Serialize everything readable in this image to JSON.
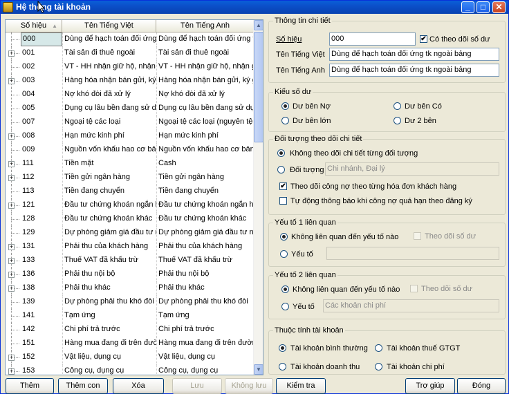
{
  "window": {
    "title": "Hệ thống tài khoản",
    "min": "_",
    "max": "□",
    "close": "✕"
  },
  "grid": {
    "headers": [
      "Số hiệu",
      "Tên Tiếng Việt",
      "Tên Tiếng Anh"
    ],
    "sort_indicator": "▲",
    "rows": [
      {
        "code": "000",
        "vn": "Dùng để hạch toán đối ứng",
        "en": "Dùng để hạch toán đối ứng t",
        "plus": false
      },
      {
        "code": "001",
        "vn": "Tài sản đi thuê ngoài",
        "en": "Tài sản đi thuê ngoài",
        "plus": true
      },
      {
        "code": "002",
        "vn": "VT - HH nhận giữ hộ, nhận g",
        "en": "VT - HH nhận giữ hộ, nhận g",
        "plus": false
      },
      {
        "code": "003",
        "vn": "Hàng hóa nhận bán gửi, ký g",
        "en": "Hàng hóa nhận bán gửi, ký g",
        "plus": true
      },
      {
        "code": "004",
        "vn": "Nợ khó đòi đã xử lý",
        "en": "Nợ khó đòi đã xử lý",
        "plus": false
      },
      {
        "code": "005",
        "vn": "Dụng cụ lâu bền đang sử dụ",
        "en": "Dụng cụ lâu bền đang sử dụ",
        "plus": false
      },
      {
        "code": "007",
        "vn": "Ngoại tệ các loại",
        "en": "Ngoại tệ các loại (nguyên tệ",
        "plus": false
      },
      {
        "code": "008",
        "vn": "Hạn mức kinh phí",
        "en": "Hạn mức kinh phí",
        "plus": true
      },
      {
        "code": "009",
        "vn": "Nguồn vốn khấu hao cơ bản",
        "en": "Nguồn vốn khấu hao cơ bản",
        "plus": false
      },
      {
        "code": "111",
        "vn": "Tiền mặt",
        "en": "Cash",
        "plus": true
      },
      {
        "code": "112",
        "vn": "Tiền gửi ngân hàng",
        "en": "Tiền gửi ngân hàng",
        "plus": true
      },
      {
        "code": "113",
        "vn": "Tiền đang chuyển",
        "en": "Tiền đang chuyển",
        "plus": false
      },
      {
        "code": "121",
        "vn": "Đầu tư chứng khoán ngắn h",
        "en": "Đầu tư chứng khoán ngắn h",
        "plus": true
      },
      {
        "code": "128",
        "vn": "Đầu tư chứng khoán khác",
        "en": "Đầu tư chứng khoán khác",
        "plus": false
      },
      {
        "code": "129",
        "vn": "Dự phòng giảm giá đầu tư n",
        "en": "Dự phòng giảm giá đầu tư n",
        "plus": false
      },
      {
        "code": "131",
        "vn": "Phải thu của khách hàng",
        "en": "Phải thu của khách hàng",
        "plus": true
      },
      {
        "code": "133",
        "vn": "Thuế VAT đã khấu trừ",
        "en": "Thuế VAT đã khấu trừ",
        "plus": true
      },
      {
        "code": "136",
        "vn": "Phải thu nội bộ",
        "en": "Phải thu nội bộ",
        "plus": true
      },
      {
        "code": "138",
        "vn": "Phải thu khác",
        "en": "Phải thu khác",
        "plus": true
      },
      {
        "code": "139",
        "vn": "Dự phòng phải thu khó đòi",
        "en": "Dự phòng phải thu khó đòi",
        "plus": false
      },
      {
        "code": "141",
        "vn": "Tạm ứng",
        "en": "Tạm ứng",
        "plus": false
      },
      {
        "code": "142",
        "vn": "Chi phí trả trước",
        "en": "Chi phí trả trước",
        "plus": false
      },
      {
        "code": "151",
        "vn": "Hàng mua đang đi trên đườn",
        "en": "Hàng mua đang đi trên đườn",
        "plus": false
      },
      {
        "code": "152",
        "vn": "Vật liệu, dụng cụ",
        "en": "Vật liệu, dụng cụ",
        "plus": true
      },
      {
        "code": "153",
        "vn": "Công cụ, dụng cụ",
        "en": "Công cụ, dụng cụ",
        "plus": true
      }
    ]
  },
  "detail": {
    "legend": "Thông tin chi tiết",
    "code_label": "Số hiệu",
    "code_value": "000",
    "track_balance_label": "Có theo dõi số dư",
    "vn_label": "Tên Tiếng Việt",
    "vn_value": "Dùng để hạch toán đối ứng tk ngoài bảng",
    "en_label": "Tên Tiếng Anh",
    "en_value": "Dùng để hạch toán đối ứng tk ngoài bảng"
  },
  "balance_type": {
    "legend": "Kiểu số dư",
    "debit": "Dư bên Nợ",
    "credit": "Dư bên Có",
    "larger": "Dư bên lớn",
    "both": "Dư 2 bên"
  },
  "tracking": {
    "legend": "Đối tượng theo dõi chi tiết",
    "none": "Không theo dõi chi tiết từng đối tượng",
    "object": "Đối tượng",
    "object_value": "Chi nhánh, Đại lý",
    "by_invoice": "Theo dõi công nợ theo từng hóa đơn khách hàng",
    "auto_notify": "Tự động thông báo khi công nợ quá hạn theo đăng ký"
  },
  "factor1": {
    "legend": "Yếu tố 1 liên quan",
    "none": "Không liên quan đến yếu tố nào",
    "track": "Theo dõi số dư",
    "factor": "Yếu tố",
    "factor_value": ""
  },
  "factor2": {
    "legend": "Yếu tố 2 liên quan",
    "none": "Không liên quan đến yếu tố nào",
    "track": "Theo dõi số dư",
    "factor": "Yếu tố",
    "factor_value": "Các khoản chi phí"
  },
  "attributes": {
    "legend": "Thuộc tính tài khoản",
    "normal": "Tài khoản bình thường",
    "vat": "Tài khoản thuế GTGT",
    "revenue": "Tài khoản doanh thu",
    "expense": "Tài khoản chi phí"
  },
  "buttons": {
    "add": "Thêm",
    "add_child": "Thêm con",
    "delete": "Xóa",
    "save": "Lưu",
    "dont_save": "Không lưu",
    "check": "Kiểm tra",
    "help": "Trợ giúp",
    "close": "Đóng"
  }
}
